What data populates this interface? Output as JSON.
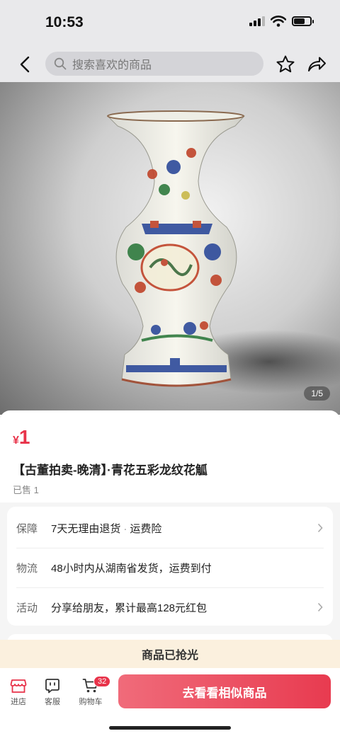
{
  "status_bar": {
    "time": "10:53"
  },
  "nav": {
    "search_placeholder": "搜索喜欢的商品"
  },
  "gallery": {
    "counter": "1/5"
  },
  "product": {
    "currency": "¥",
    "price": "1",
    "title": "【古董拍卖-晚清】·青花五彩龙纹花觚",
    "sold": "已售 1"
  },
  "services": [
    {
      "label": "保障",
      "value_a": "7天无理由退货",
      "sep": "·",
      "value_b": "运费险",
      "chevron": true
    },
    {
      "label": "物流",
      "value": "48小时内从湖南省发货，运费到付",
      "chevron": false
    },
    {
      "label": "活动",
      "value": "分享给朋友，累计最高128元红包",
      "chevron": true
    }
  ],
  "banner": {
    "text": "商品已抢光"
  },
  "bottom_bar": {
    "store_label": "进店",
    "service_label": "客服",
    "cart_label": "购物车",
    "cart_count": "32",
    "cta_label": "去看看相似商品"
  },
  "colors": {
    "accent": "#e8334a",
    "banner_bg": "#fbf0de"
  },
  "icons": [
    "back-icon",
    "search-icon",
    "star-icon",
    "share-icon",
    "store-icon",
    "customer-service-icon",
    "cart-icon",
    "chevron-right-icon"
  ]
}
